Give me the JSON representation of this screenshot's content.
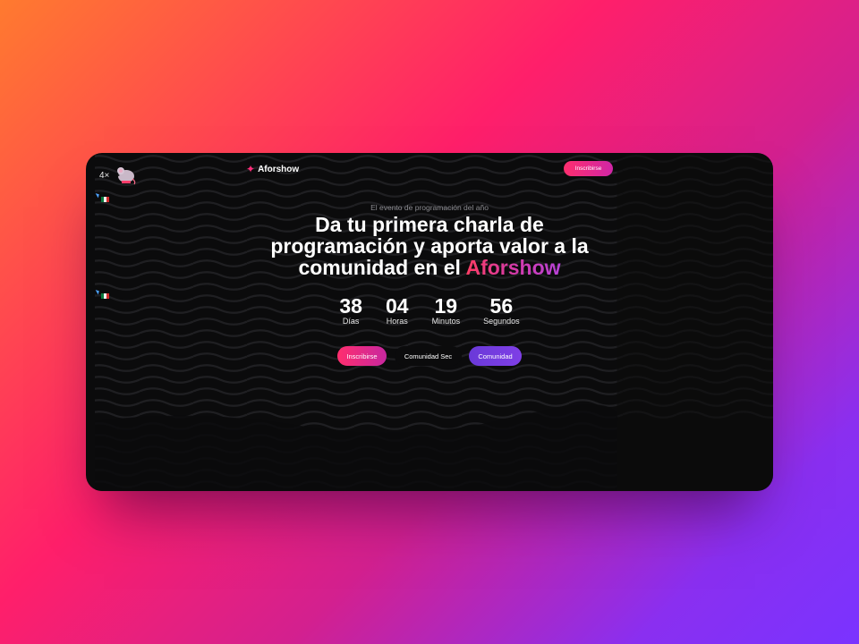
{
  "brand": {
    "name": "Aforshow",
    "icon": "sparkle-icon",
    "accent": "#ff2d7a"
  },
  "nav": {
    "register_label": "Inscribirse"
  },
  "side_widget": {
    "multiplier": "4×",
    "icon": "mouse-icon"
  },
  "hero": {
    "subtitle": "El evento de programación del año",
    "headline": "Da tu primera charla de programación y aporta valor a la comunidad en el",
    "headline_accent": "Aforshow"
  },
  "countdown": [
    {
      "value": "38",
      "label": "Días"
    },
    {
      "value": "04",
      "label": "Horas"
    },
    {
      "value": "19",
      "label": "Minutos"
    },
    {
      "value": "56",
      "label": "Segundos"
    }
  ],
  "actions": {
    "register_label": "Inscribirse",
    "secondary_label": "Comunidad Sec",
    "community_label": "Comunidad"
  },
  "colors": {
    "pink": "#ff2e6e",
    "purple": "#7f3fe6",
    "panel_bg": "#0b0b0c"
  }
}
